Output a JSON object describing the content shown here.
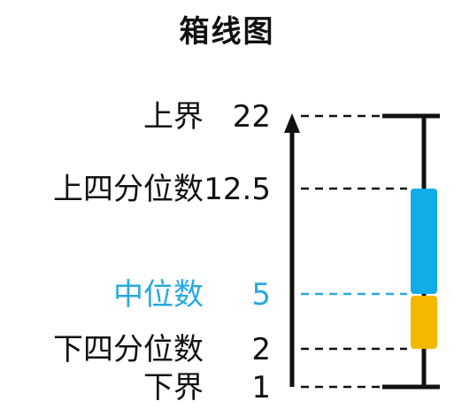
{
  "title": "箱线图",
  "labels": [
    {
      "key": "upper_whisker",
      "name": "上界",
      "value_text": "22",
      "value": 22
    },
    {
      "key": "q3",
      "name": "上四分位数",
      "value_text": "12.5",
      "value": 12.5
    },
    {
      "key": "median",
      "name": "中位数",
      "value_text": "5",
      "value": 5
    },
    {
      "key": "q1",
      "name": "下四分位数",
      "value_text": "2",
      "value": 2
    },
    {
      "key": "lower_whisker",
      "name": "下界",
      "value_text": "1",
      "value": 1
    }
  ],
  "colors": {
    "text": "#111111",
    "median": "#29a9e0",
    "upper_box": "#12ace8",
    "lower_box": "#f5b800",
    "line": "#111111"
  }
}
